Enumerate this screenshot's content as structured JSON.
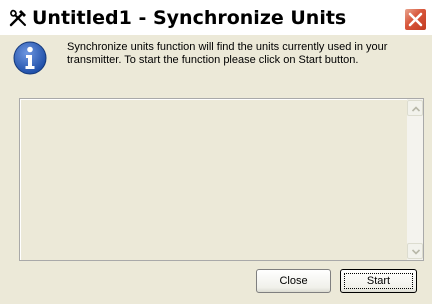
{
  "window": {
    "title": "Untitled1 - Synchronize Units",
    "app_icon": "tools-icon",
    "close_icon": "close-icon"
  },
  "message": {
    "icon": "info-icon",
    "line1": "Synchronize units function will find the units currently used in your",
    "line2": "transmitter. To start the function please click on Start button."
  },
  "units_list": {
    "items": []
  },
  "buttons": {
    "close_label": "Close",
    "start_label": "Start"
  },
  "colors": {
    "background": "#ece9d8",
    "titlebar": "#ffffff",
    "close_button": "#d8553a",
    "info_blue": "#1f4fa8"
  }
}
